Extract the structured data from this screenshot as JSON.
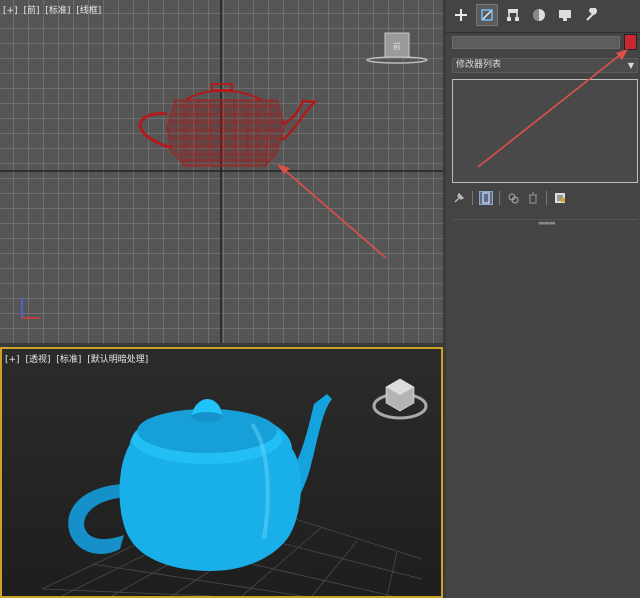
{
  "front_viewport": {
    "labels": [
      "[+]",
      "[前]",
      "[标准]",
      "[线框]"
    ],
    "cube_label": "前",
    "teapot_color": "#b01a1a"
  },
  "persp_viewport": {
    "labels": [
      "[+]",
      "[透视]",
      "[标准]",
      "[默认明暗处理]"
    ],
    "teapot_color": "#1aa8e0",
    "border_color": "#c9a227"
  },
  "command_panel": {
    "tabs": [
      "create-icon",
      "modify-icon",
      "hierarchy-icon",
      "motion-icon",
      "display-icon",
      "utilities-icon"
    ],
    "active_tab": "modify-icon",
    "object_name": "",
    "object_color": "#c8282f",
    "modifier_list_label": "修改器列表"
  },
  "annotation_color": "#e0504a"
}
